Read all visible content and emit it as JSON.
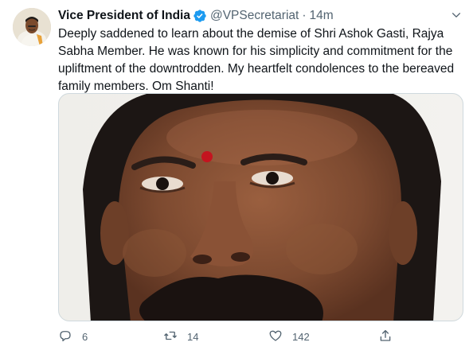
{
  "tweet": {
    "display_name": "Vice President of India",
    "handle": "@VPSecretariat",
    "separator": "·",
    "time": "14m",
    "text": "Deeply saddened to learn about the demise of Shri Ashok Gasti, Rajya Sabha Member. He was known for his simplicity and commitment for the upliftment of the downtrodden. My heartfelt condolences to the bereaved family members. Om Shanti!",
    "media_icon": "portrait-photo",
    "avatar_icon": "profile-photo"
  },
  "actions": {
    "reply_count": "6",
    "retweet_count": "14",
    "like_count": "142",
    "reply_icon": "reply-icon",
    "retweet_icon": "retweet-icon",
    "like_icon": "heart-icon",
    "share_icon": "share-icon"
  },
  "colors": {
    "text": "#0f1419",
    "secondary": "#536471",
    "verified": "#1d9bf0",
    "border": "#cfd9de"
  }
}
